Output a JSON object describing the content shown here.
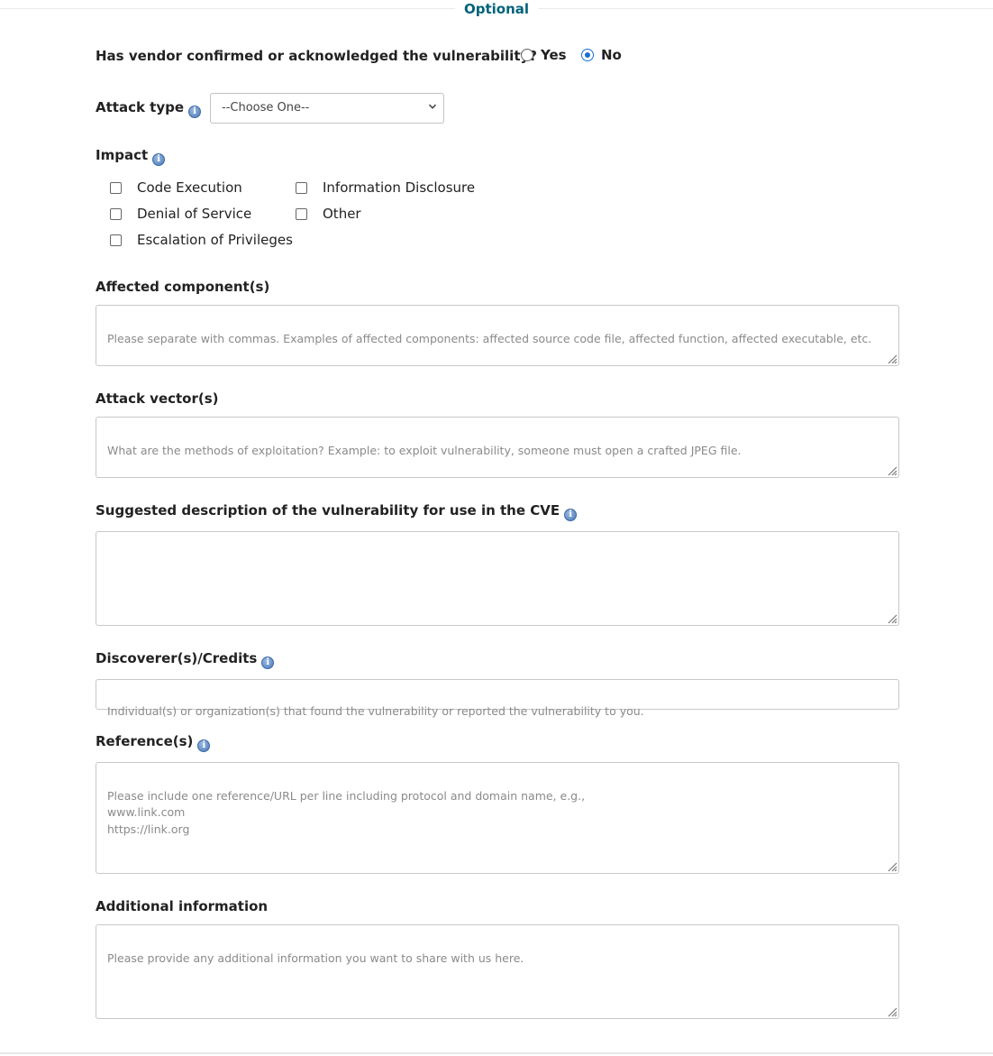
{
  "section": {
    "title": "Optional"
  },
  "vendor_question": {
    "label": "Has vendor confirmed or acknowledged the vulnerability?",
    "options": [
      {
        "label": "Yes",
        "selected": false
      },
      {
        "label": "No",
        "selected": true
      }
    ]
  },
  "attack_type": {
    "label": "Attack type",
    "selected": "--Choose One--",
    "icon": "info-icon"
  },
  "impact": {
    "label": "Impact",
    "icon": "info-icon",
    "options": [
      {
        "label": "Code Execution",
        "checked": false
      },
      {
        "label": "Denial of Service",
        "checked": false
      },
      {
        "label": "Escalation of Privileges",
        "checked": false
      },
      {
        "label": "Information Disclosure",
        "checked": false
      },
      {
        "label": "Other",
        "checked": false
      }
    ]
  },
  "affected_components": {
    "label": "Affected component(s)",
    "placeholder": "Please separate with commas. Examples of affected components: affected source code file, affected function, affected executable, etc.",
    "value": ""
  },
  "attack_vectors": {
    "label": "Attack vector(s)",
    "placeholder": "What are the methods of exploitation? Example: to exploit vulnerability, someone must open a crafted JPEG file.",
    "value": ""
  },
  "suggested_description": {
    "label": "Suggested description of the vulnerability for use in the CVE",
    "icon": "info-icon",
    "placeholder": "",
    "value": ""
  },
  "discoverers": {
    "label": "Discoverer(s)/Credits",
    "icon": "info-icon",
    "placeholder": "Individual(s) or organization(s) that found the vulnerability or reported the vulnerability to you.",
    "value": ""
  },
  "references": {
    "label": "Reference(s)",
    "icon": "info-icon",
    "placeholder": "Please include one reference/URL per line including protocol and domain name, e.g.,\nwww.link.com\nhttps://link.org",
    "value": ""
  },
  "additional_info": {
    "label": "Additional information",
    "placeholder": "Please provide any additional information you want to share with us here.",
    "value": ""
  },
  "colors": {
    "section_title": "#00627a",
    "radio_accent": "#1a6fd1",
    "info_icon": "#4a78b8"
  }
}
